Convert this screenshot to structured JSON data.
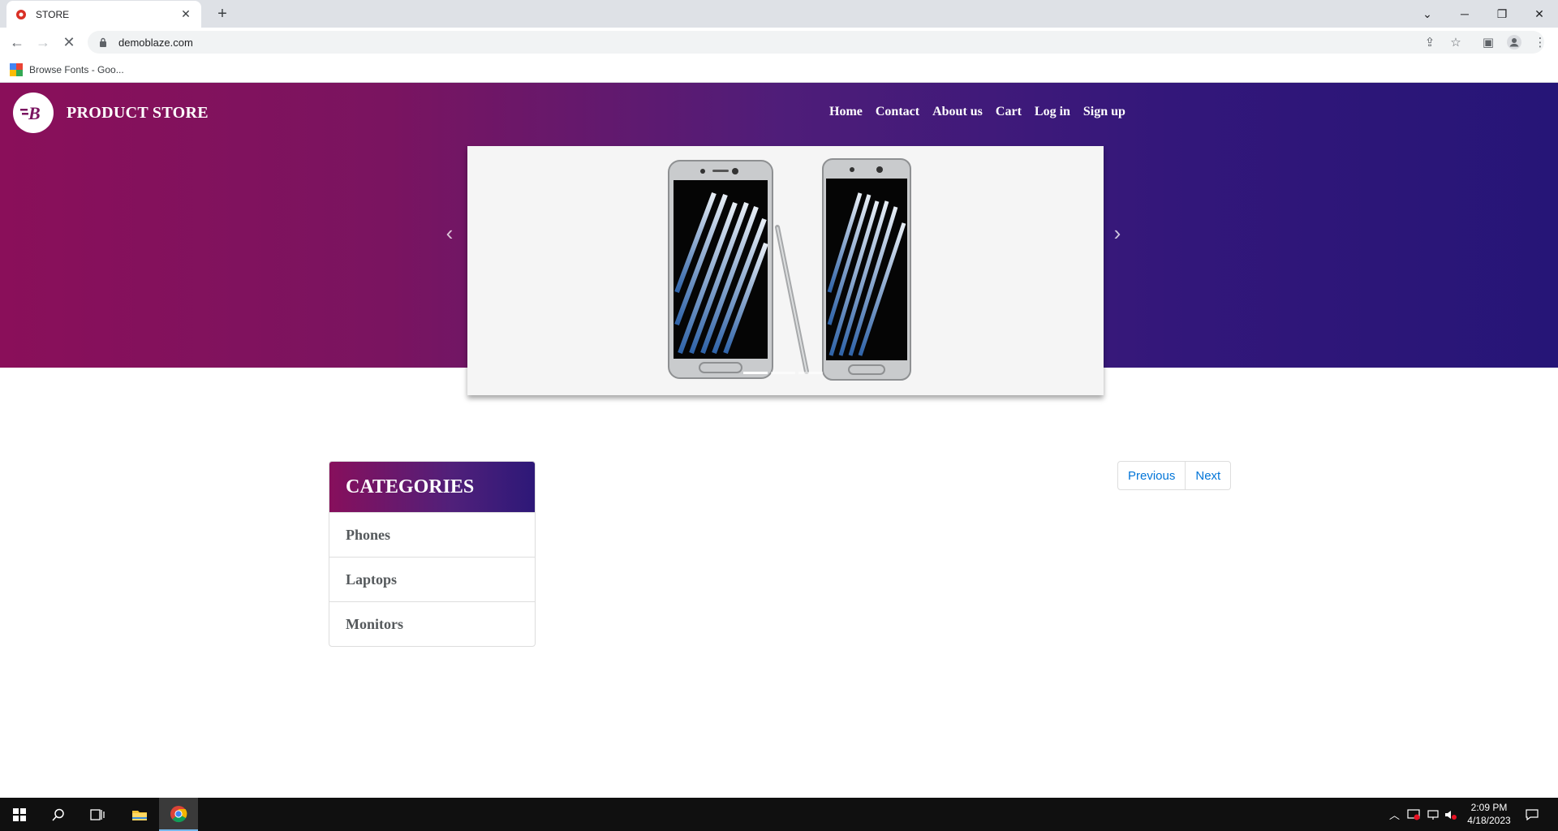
{
  "browser": {
    "tab_title": "STORE",
    "new_tab_label": "+",
    "url": "demoblaze.com",
    "bookmark": "Browse Fonts - Goo..."
  },
  "site": {
    "brand": "PRODUCT STORE",
    "nav": [
      "Home",
      "Contact",
      "About us",
      "Cart",
      "Log in",
      "Sign up"
    ],
    "categories_title": "CATEGORIES",
    "categories": [
      "Phones",
      "Laptops",
      "Monitors"
    ],
    "pager": {
      "previous": "Previous",
      "next": "Next"
    },
    "carousel": {
      "slide_count": 3,
      "active_slide": 1
    }
  },
  "taskbar": {
    "time": "2:09 PM",
    "date": "4/18/2023"
  },
  "colors": {
    "hero_start": "#8a0f5a",
    "hero_end": "#261577",
    "link": "#0275d8"
  }
}
